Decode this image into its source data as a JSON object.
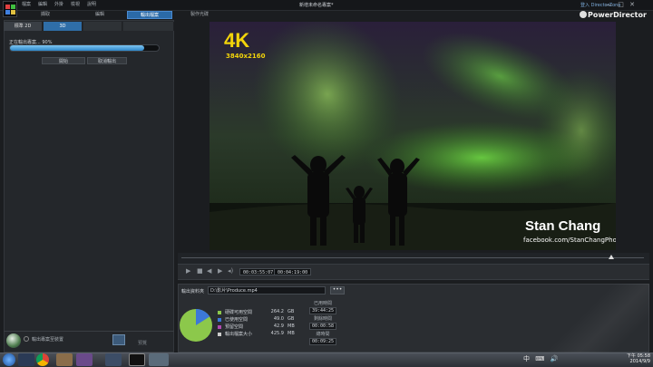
{
  "titlebar": {
    "menus": [
      "檔案",
      "編輯",
      "外掛",
      "檢視",
      "說明"
    ],
    "document_title": "新增未命名專案*",
    "signin": "登入 DirectorZone",
    "window_controls": "— □ ✕",
    "brand": "PowerDirector"
  },
  "top_tabs": [
    "擷取",
    "編輯",
    "輸出檔案",
    "製作光碟"
  ],
  "top_tab_active": 2,
  "left_panel": {
    "subtabs": [
      "標準 2D",
      "3D",
      "",
      "",
      ""
    ],
    "progress_label": "正在輸出專案... 90%",
    "progress_value": 0.9,
    "buttons": {
      "start": "開始",
      "cancel": "取消輸出"
    },
    "bottom_option_label": "輸出專案至裝置",
    "bottom_preview_label": "預覽"
  },
  "preview": {
    "badge": "4K",
    "resolution": "3840x2160",
    "watermark_name": "Stan Chang",
    "watermark_url": "facebook.com/StanChangPhoto"
  },
  "playback": {
    "timecode_current": "00:03:55:07",
    "timecode_total": "00:04:19:00",
    "playhead_fraction": 0.93
  },
  "output": {
    "folder_label": "輸出資料夾",
    "folder_path": "D:\\影片\\Produce.mp4",
    "browse_label": "•••",
    "disk": [
      {
        "label": "硬碟可用空間",
        "value": "264.2",
        "unit": "GB",
        "color": "#8cc84b"
      },
      {
        "label": "已使用空間",
        "value": "49.0",
        "unit": "GB",
        "color": "#3c78d8"
      },
      {
        "label": "預留空間",
        "value": "42.9",
        "unit": "MB",
        "color": "#b04ab0"
      },
      {
        "label": "輸出檔案大小",
        "value": "425.9",
        "unit": "MB",
        "color": "#cccccc"
      }
    ],
    "pie_fractions": [
      0.84,
      0.16
    ],
    "times": [
      {
        "label": "已用時間",
        "value": "39:44:25"
      },
      {
        "label": "剩餘時間",
        "value": "00:00:58"
      },
      {
        "label": "總時間",
        "value": "00:09:25"
      }
    ]
  },
  "taskbar": {
    "tray": "中 ⌨ 🔊",
    "time": "下午 05:58",
    "date": "2014/9/9"
  },
  "colors": {
    "accent": "#2b6aa8",
    "panel": "#24272b",
    "aurora": "#5fbf3a"
  }
}
